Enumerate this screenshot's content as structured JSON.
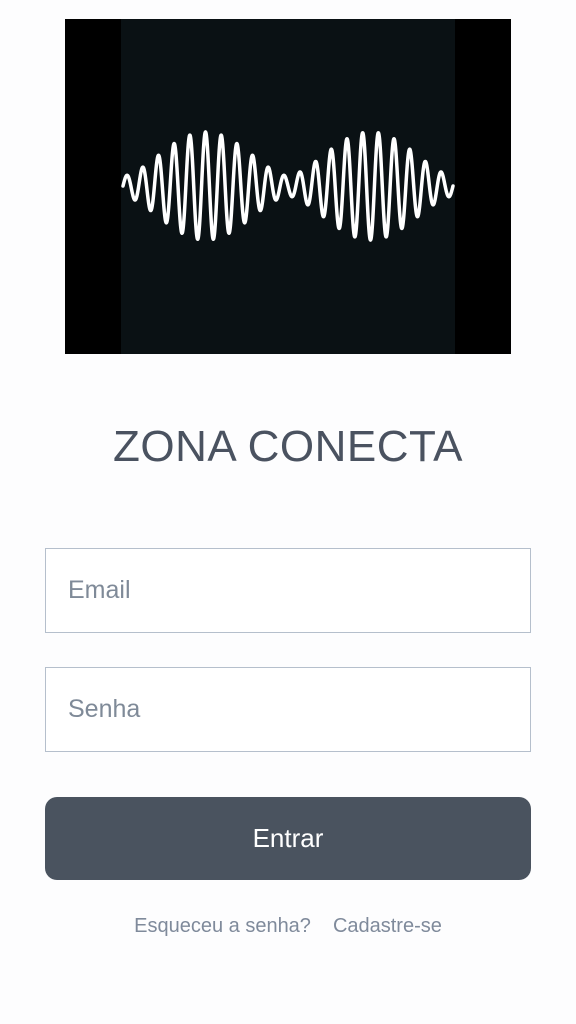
{
  "app": {
    "title": "ZONA CONECTA",
    "logo_icon": "sound-wave-icon"
  },
  "form": {
    "email_placeholder": "Email",
    "email_value": "",
    "password_placeholder": "Senha",
    "password_value": "",
    "submit_label": "Entrar"
  },
  "links": {
    "forgot_password": "Esqueceu a senha?",
    "sign_up": "Cadastre-se"
  },
  "colors": {
    "button_bg": "#4a535f",
    "title_text": "#4a5260",
    "link_text": "#7f8a9b",
    "input_border": "#b5bfcc"
  }
}
